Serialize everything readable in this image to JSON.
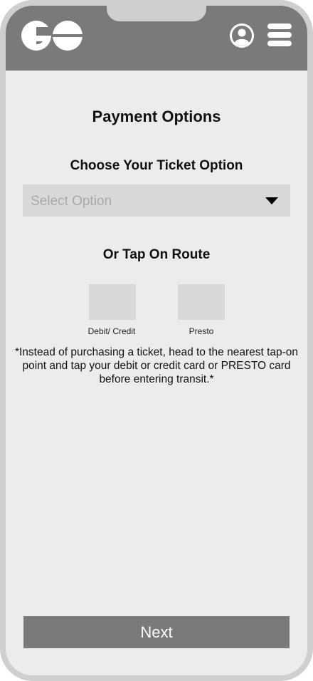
{
  "header": {
    "logo_icon": "go-transit-logo-icon",
    "profile_icon": "user-circle-icon",
    "menu_icon": "hamburger-menu-icon"
  },
  "page": {
    "title": "Payment Options",
    "ticket_heading": "Choose Your Ticket Option",
    "select_placeholder": "Select Option",
    "tap_heading": "Or Tap On Route",
    "options": [
      {
        "label": "Debit/ Credit"
      },
      {
        "label": "Presto"
      }
    ],
    "note": "*Instead of purchasing a ticket, head to the nearest tap-on point and tap your debit or credit card or PRESTO card before entering transit.*"
  },
  "footer": {
    "next_label": "Next"
  },
  "colors": {
    "header": "#7a7a7a",
    "background": "#ececec",
    "placeholder_box": "#d9d9d9",
    "frame": "#cfcfcf"
  }
}
